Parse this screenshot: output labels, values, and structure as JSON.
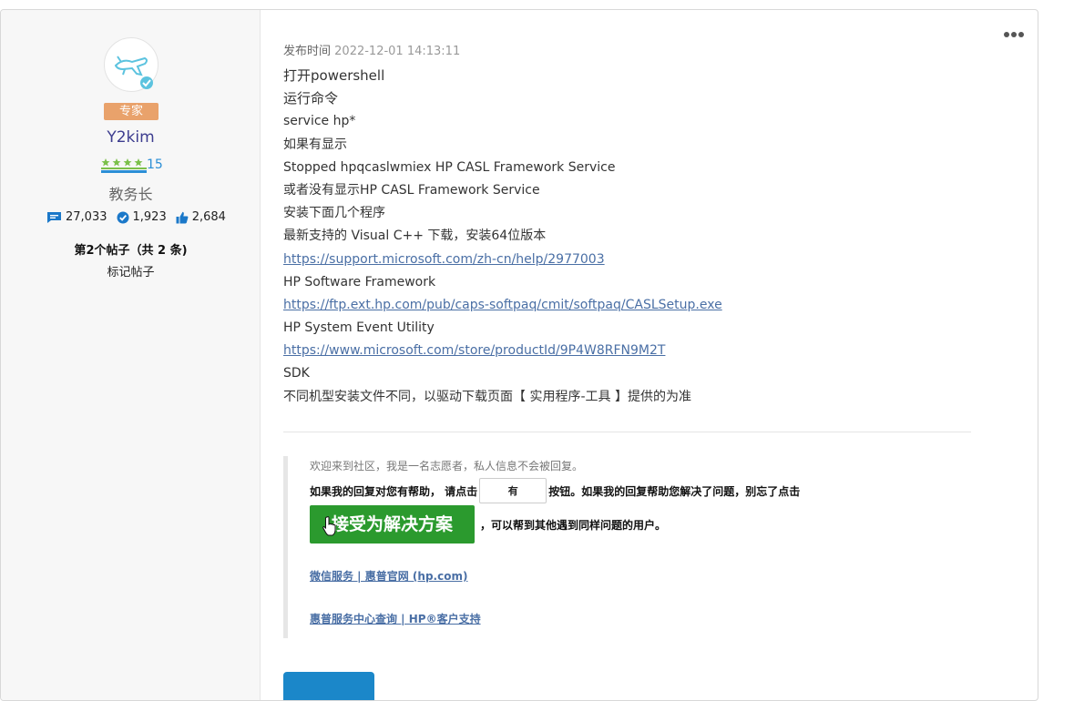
{
  "author": {
    "avatar_icon": "airplane-avatar-icon",
    "badge": "专家",
    "username": "Y2kim",
    "level": "15",
    "stars": 4,
    "role": "教务长",
    "stats": {
      "messages": "27,033",
      "solutions": "1,923",
      "kudos": "2,684"
    },
    "post_number": "第2个帖子（共 2 条)",
    "mark_post": "标记帖子"
  },
  "post": {
    "time_label": "发布时间",
    "timestamp": "2022-12-01 14:13:11",
    "menu_icon": "more-options-icon",
    "lines": [
      {
        "text": "打开powershell",
        "type": "text"
      },
      {
        "text": "运行命令",
        "type": "text"
      },
      {
        "text": "service hp*",
        "type": "text"
      },
      {
        "text": "如果有显示",
        "type": "text"
      },
      {
        "text": "Stopped hpqcaslwmiex HP CASL Framework Service",
        "type": "text"
      },
      {
        "text": "或者没有显示HP CASL Framework Service",
        "type": "text"
      },
      {
        "text": "安装下面几个程序",
        "type": "text"
      },
      {
        "text": "最新支持的 Visual C++ 下载，安装64位版本",
        "type": "text"
      },
      {
        "text": "https://support.microsoft.com/zh-cn/help/2977003",
        "type": "link"
      },
      {
        "text": "HP Software Framework",
        "type": "text"
      },
      {
        "text": "https://ftp.ext.hp.com/pub/caps-softpaq/cmit/softpaq/CASLSetup.exe",
        "type": "link"
      },
      {
        "text": "HP System Event Utility",
        "type": "text"
      },
      {
        "text": "https://www.microsoft.com/store/productId/9P4W8RFN9M2T",
        "type": "link"
      },
      {
        "text": "SDK",
        "type": "text"
      },
      {
        "text": "不同机型安装文件不同，以驱动下载页面【 实用程序-工具 】提供的为准",
        "type": "text"
      }
    ]
  },
  "signature": {
    "welcome": "欢迎来到社区，我是一名志愿者，私人信息不会被回复。",
    "help_prefix": "如果我的回复对您有帮助，  请点击",
    "yes_button": "有",
    "help_suffix": "按钮。如果我的回复帮助您解决了问题，别忘了点击",
    "accept_button": "接受为解决方案",
    "accept_tail": "，可以帮到其他遇到同样问题的用户。",
    "link1": "微信服务 | 惠普官网 (hp.com)",
    "link2": "惠普服务中心查询 | HP®客户支持"
  },
  "colors": {
    "accent_green": "#2b9a2e",
    "badge_orange": "#e9a26b",
    "link_blue": "#4a6fa5",
    "reply_blue": "#1b87c9"
  }
}
